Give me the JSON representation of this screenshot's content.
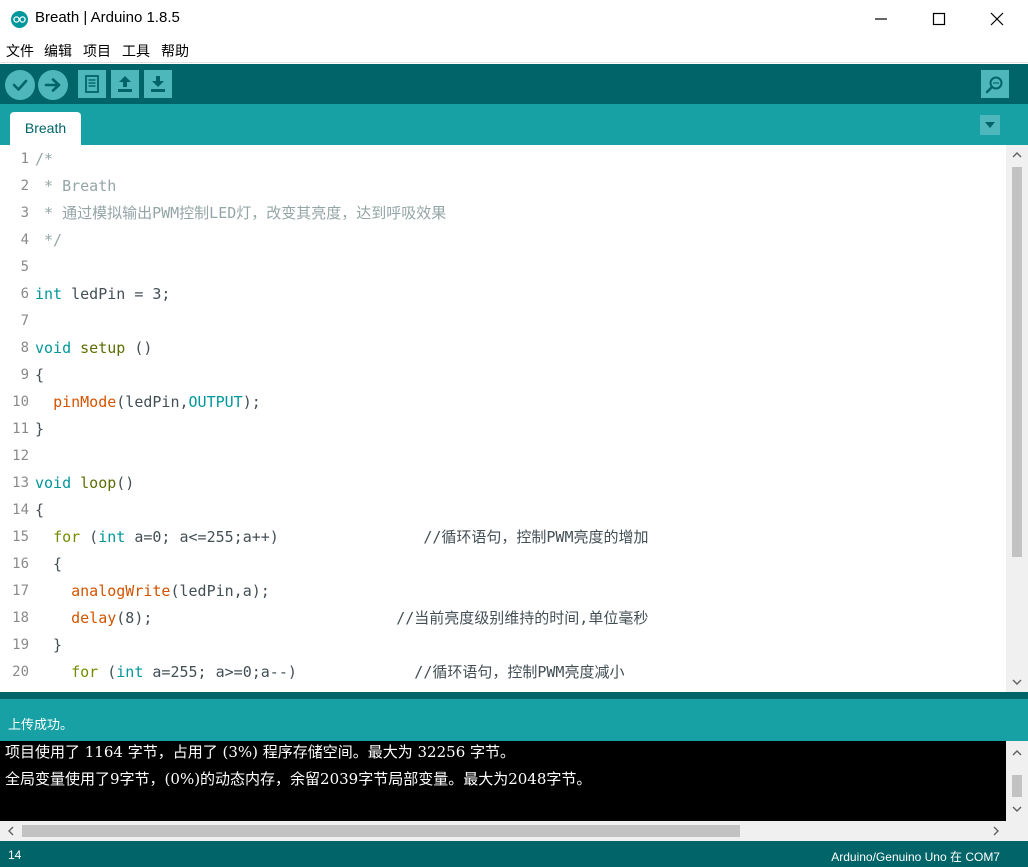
{
  "window": {
    "title": "Breath | Arduino 1.8.5"
  },
  "menu": [
    "文件",
    "编辑",
    "项目",
    "工具",
    "帮助"
  ],
  "toolbar": {
    "buttons": [
      "verify-icon",
      "upload-icon",
      "new-icon",
      "open-icon",
      "save-icon"
    ],
    "serial_monitor": "serial-monitor-icon"
  },
  "tabs": [
    {
      "label": "Breath"
    }
  ],
  "editor": {
    "lines": [
      {
        "n": "1",
        "tokens": [
          {
            "t": "/*",
            "c": "comment"
          }
        ]
      },
      {
        "n": "2",
        "tokens": [
          {
            "t": " * Breath",
            "c": "comment"
          }
        ]
      },
      {
        "n": "3",
        "tokens": [
          {
            "t": " * 通过模拟输出PWM控制LED灯，改变其亮度，达到呼吸效果",
            "c": "comment"
          }
        ]
      },
      {
        "n": "4",
        "tokens": [
          {
            "t": " */",
            "c": "comment"
          }
        ]
      },
      {
        "n": "5",
        "tokens": []
      },
      {
        "n": "6",
        "tokens": [
          {
            "t": "int",
            "c": "type"
          },
          {
            "t": " ledPin = 3;",
            "c": "plain"
          }
        ]
      },
      {
        "n": "7",
        "tokens": []
      },
      {
        "n": "8",
        "tokens": [
          {
            "t": "void",
            "c": "type"
          },
          {
            "t": " ",
            "c": "plain"
          },
          {
            "t": "setup",
            "c": "fn2"
          },
          {
            "t": " ()",
            "c": "plain"
          }
        ]
      },
      {
        "n": "9",
        "tokens": [
          {
            "t": "{",
            "c": "plain"
          }
        ]
      },
      {
        "n": "10",
        "tokens": [
          {
            "t": "  ",
            "c": "plain"
          },
          {
            "t": "pinMode",
            "c": "func"
          },
          {
            "t": "(ledPin,",
            "c": "plain"
          },
          {
            "t": "OUTPUT",
            "c": "const"
          },
          {
            "t": ");",
            "c": "plain"
          }
        ]
      },
      {
        "n": "11",
        "tokens": [
          {
            "t": "}",
            "c": "plain"
          }
        ]
      },
      {
        "n": "12",
        "tokens": []
      },
      {
        "n": "13",
        "tokens": [
          {
            "t": "void",
            "c": "type"
          },
          {
            "t": " ",
            "c": "plain"
          },
          {
            "t": "loop",
            "c": "fn2"
          },
          {
            "t": "()",
            "c": "plain"
          }
        ]
      },
      {
        "n": "14",
        "tokens": [
          {
            "t": "{",
            "c": "plain"
          }
        ]
      },
      {
        "n": "15",
        "tokens": [
          {
            "t": "  ",
            "c": "plain"
          },
          {
            "t": "for",
            "c": "kw"
          },
          {
            "t": " (",
            "c": "plain"
          },
          {
            "t": "int",
            "c": "type"
          },
          {
            "t": " a=0; a<=255;a++)                //循环语句，控制PWM亮度的增加",
            "c": "plain"
          }
        ]
      },
      {
        "n": "16",
        "tokens": [
          {
            "t": "  {",
            "c": "plain"
          }
        ]
      },
      {
        "n": "17",
        "tokens": [
          {
            "t": "    ",
            "c": "plain"
          },
          {
            "t": "analogWrite",
            "c": "func"
          },
          {
            "t": "(ledPin,a);",
            "c": "plain"
          }
        ]
      },
      {
        "n": "18",
        "tokens": [
          {
            "t": "    ",
            "c": "plain"
          },
          {
            "t": "delay",
            "c": "func"
          },
          {
            "t": "(8);                           //当前亮度级别维持的时间,单位毫秒",
            "c": "plain"
          }
        ]
      },
      {
        "n": "19",
        "tokens": [
          {
            "t": "  }",
            "c": "plain"
          }
        ]
      },
      {
        "n": "20",
        "tokens": [
          {
            "t": "    ",
            "c": "plain"
          },
          {
            "t": "for",
            "c": "kw"
          },
          {
            "t": " (",
            "c": "plain"
          },
          {
            "t": "int",
            "c": "type"
          },
          {
            "t": " a=255; a>=0;a--)             //循环语句，控制PWM亮度减小",
            "c": "plain"
          }
        ]
      }
    ]
  },
  "status": {
    "message": "上传成功。"
  },
  "console": {
    "lines": [
      "项目使用了 1164 字节，占用了 (3%) 程序存储空间。最大为 32256 字节。",
      "全局变量使用了9字节，(0%)的动态内存，余留2039字节局部变量。最大为2048字节。"
    ]
  },
  "footer": {
    "line": "14",
    "board": "Arduino/Genuino Uno 在 COM7"
  },
  "colors": {
    "teal_dark": "#006468",
    "teal": "#17a1a5",
    "button": "#4db7bb"
  }
}
